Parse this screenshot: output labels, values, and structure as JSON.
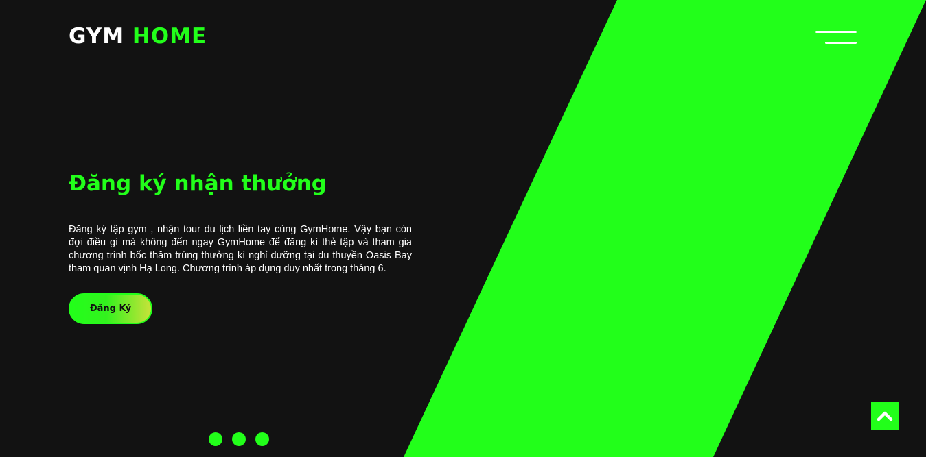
{
  "colors": {
    "background": "#121212",
    "accent": "#22ff1a",
    "text": "#ffffff"
  },
  "header": {
    "logo_part1": "GYM",
    "logo_part2": "HOME",
    "menu_icon": "hamburger-menu-icon"
  },
  "hero": {
    "title": "Đăng ký nhận thưởng",
    "description": "Đăng ký tập gym , nhận tour du lịch liền tay cùng GymHome. Vậy bạn còn đợi điều gì mà không đến ngay GymHome để đăng kí thẻ tập và tham gia chương trình bốc thăm trúng thưởng kì nghỉ dưỡng tại du thuyền Oasis Bay tham quan vịnh Hạ Long. Chương trình áp dụng duy nhất trong tháng 6.",
    "button_label": "Đăng Ký"
  },
  "slider": {
    "dot_count": 3
  },
  "back_to_top": {
    "icon": "chevron-up-icon"
  }
}
